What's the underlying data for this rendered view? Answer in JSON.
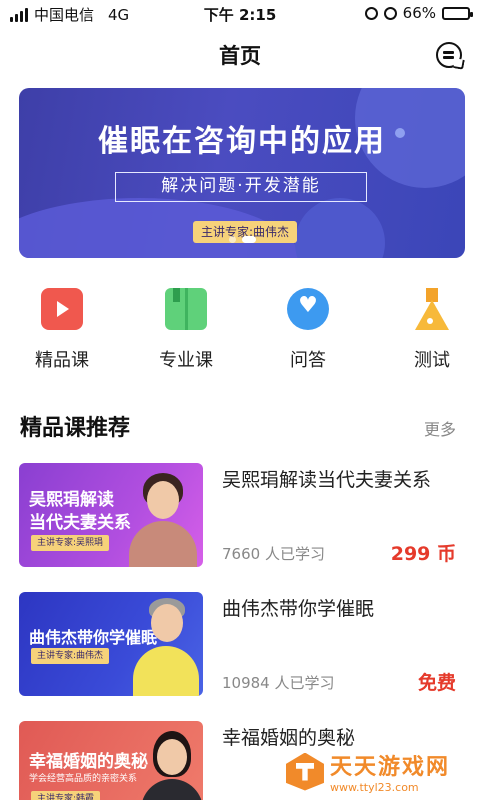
{
  "status_bar": {
    "carrier": "中国电信",
    "network": "4G",
    "time": "下午 2:15",
    "battery_percent": "66%",
    "battery_level": 0.66
  },
  "nav": {
    "title": "首页",
    "message_icon": "chat-bubble-icon"
  },
  "banner": {
    "title": "催眠在咨询中的应用",
    "subtitle": "解决问题·开发潜能",
    "tag": "主讲专家:曲伟杰",
    "pager_count": 2,
    "active_index": 1
  },
  "categories": [
    {
      "label": "精品课",
      "icon": "video-icon",
      "color": "#f0584e"
    },
    {
      "label": "专业课",
      "icon": "book-icon",
      "color": "#5fd17a"
    },
    {
      "label": "问答",
      "icon": "heart-chat-icon",
      "color": "#3d9af0"
    },
    {
      "label": "测试",
      "icon": "flask-icon",
      "color": "#f7b93a"
    }
  ],
  "section": {
    "title": "精品课推荐",
    "more": "更多"
  },
  "courses": [
    {
      "title": "吴熙琄解读当代夫妻关系",
      "thumb_line1": "吴熙琄解读",
      "thumb_line2": "当代夫妻关系",
      "thumb_tag": "主讲专家:吴熙琄",
      "count": "7660 人已学习",
      "price": "299 币"
    },
    {
      "title": "曲伟杰带你学催眠",
      "thumb_line1": "曲伟杰带你学催眠",
      "thumb_tag": "主讲专家:曲伟杰",
      "count": "10984 人已学习",
      "price": "免费"
    },
    {
      "title": "幸福婚姻的奥秘",
      "thumb_line1": "幸福婚姻的奥秘",
      "thumb_line2": "学会经营高品质的亲密关系",
      "thumb_tag": "主讲专家:韩霞"
    }
  ],
  "watermark": {
    "name": "天天游戏网",
    "url": "www.ttyl23.com"
  },
  "colors": {
    "accent_price": "#e53a2b",
    "banner": "#4b4cc0"
  }
}
